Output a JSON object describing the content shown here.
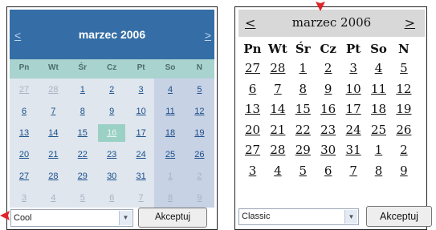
{
  "cool": {
    "prev": "<",
    "next": ">",
    "title": "marzec 2006",
    "day_names": [
      "Pn",
      "Wt",
      "Śr",
      "Cz",
      "Pt",
      "So",
      "N"
    ],
    "weeks": [
      [
        {
          "d": "27",
          "other": true
        },
        {
          "d": "28",
          "other": true
        },
        {
          "d": "1"
        },
        {
          "d": "2"
        },
        {
          "d": "3"
        },
        {
          "d": "4"
        },
        {
          "d": "5"
        }
      ],
      [
        {
          "d": "6"
        },
        {
          "d": "7"
        },
        {
          "d": "8"
        },
        {
          "d": "9"
        },
        {
          "d": "10"
        },
        {
          "d": "11"
        },
        {
          "d": "12"
        }
      ],
      [
        {
          "d": "13"
        },
        {
          "d": "14"
        },
        {
          "d": "15"
        },
        {
          "d": "16",
          "today": true
        },
        {
          "d": "17"
        },
        {
          "d": "18"
        },
        {
          "d": "19"
        }
      ],
      [
        {
          "d": "20"
        },
        {
          "d": "21"
        },
        {
          "d": "22"
        },
        {
          "d": "23"
        },
        {
          "d": "24"
        },
        {
          "d": "25"
        },
        {
          "d": "26"
        }
      ],
      [
        {
          "d": "27"
        },
        {
          "d": "28"
        },
        {
          "d": "29"
        },
        {
          "d": "30"
        },
        {
          "d": "31"
        },
        {
          "d": "1",
          "other": true
        },
        {
          "d": "2",
          "other": true
        }
      ],
      [
        {
          "d": "3",
          "other": true
        },
        {
          "d": "4",
          "other": true
        },
        {
          "d": "5",
          "other": true
        },
        {
          "d": "6",
          "other": true
        },
        {
          "d": "7",
          "other": true
        },
        {
          "d": "8",
          "other": true
        },
        {
          "d": "9",
          "other": true
        }
      ]
    ],
    "select_value": "Cool",
    "accept_label": "Akceptuj"
  },
  "classic": {
    "prev": "<",
    "next": ">",
    "title": "marzec 2006",
    "day_names": [
      "Pn",
      "Wt",
      "Śr",
      "Cz",
      "Pt",
      "So",
      "N"
    ],
    "weeks": [
      [
        "27",
        "28",
        "1",
        "2",
        "3",
        "4",
        "5"
      ],
      [
        "6",
        "7",
        "8",
        "9",
        "10",
        "11",
        "12"
      ],
      [
        "13",
        "14",
        "15",
        "16",
        "17",
        "18",
        "19"
      ],
      [
        "20",
        "21",
        "22",
        "23",
        "24",
        "25",
        "26"
      ],
      [
        "27",
        "28",
        "29",
        "30",
        "31",
        "1",
        "2"
      ],
      [
        "3",
        "4",
        "5",
        "6",
        "7",
        "8",
        "9"
      ]
    ],
    "select_value": "Classic",
    "accept_label": "Akceptuj"
  },
  "colors": {
    "cool_header": "#356ea6",
    "cool_dayrow": "#a9d3cf",
    "cool_weekend": "#c8d2e5",
    "cool_today": "#9bd0c4",
    "pointer_arrow": "#e0242a"
  },
  "icons": {
    "pointer_arrows": "red-arrow-icon",
    "select_arrow": "chevron-down-icon"
  }
}
